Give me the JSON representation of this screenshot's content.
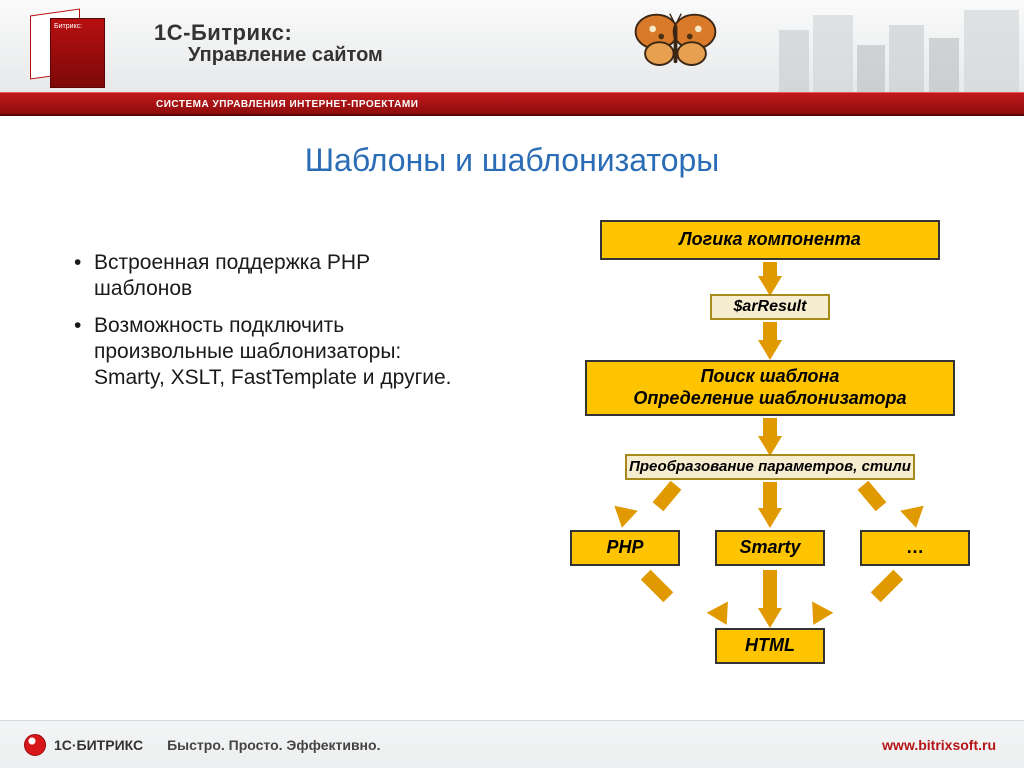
{
  "header": {
    "brand_top": "1С-Битрикс:",
    "brand_bottom": "Управление сайтом",
    "box_label": "Битрикс:",
    "redbar": "СИСТЕМА УПРАВЛЕНИЯ ИНТЕРНЕТ-ПРОЕКТАМИ"
  },
  "slide": {
    "title": "Шаблоны и шаблонизаторы",
    "bullets": [
      "Встроенная поддержка PHP шаблонов",
      "Возможность подключить произвольные шаблонизаторы: Smarty, XSLT, FastTemplate и другие."
    ]
  },
  "diagram": {
    "logic": "Логика компонента",
    "arresult": "$arResult",
    "search_line1": "Поиск шаблона",
    "search_line2": "Определение шаблонизатора",
    "params": "Преобразование параметров, стили",
    "php": "PHP",
    "smarty": "Smarty",
    "dots": "…",
    "html": "HTML"
  },
  "footer": {
    "logo_text": "1С·БИТРИКС",
    "tagline": "Быстро. Просто. Эффективно.",
    "url": "www.bitrixsoft.ru"
  },
  "chart_data": {
    "type": "flow-diagram",
    "nodes": [
      {
        "id": "logic",
        "label": "Логика компонента",
        "kind": "primary"
      },
      {
        "id": "arresult",
        "label": "$arResult",
        "kind": "data"
      },
      {
        "id": "search",
        "label": "Поиск шаблона / Определение шаблонизатора",
        "kind": "primary"
      },
      {
        "id": "params",
        "label": "Преобразование параметров, стили",
        "kind": "data"
      },
      {
        "id": "php",
        "label": "PHP",
        "kind": "engine"
      },
      {
        "id": "smarty",
        "label": "Smarty",
        "kind": "engine"
      },
      {
        "id": "other",
        "label": "…",
        "kind": "engine"
      },
      {
        "id": "html",
        "label": "HTML",
        "kind": "output"
      }
    ],
    "edges": [
      [
        "logic",
        "arresult"
      ],
      [
        "arresult",
        "search"
      ],
      [
        "search",
        "params"
      ],
      [
        "params",
        "php"
      ],
      [
        "params",
        "smarty"
      ],
      [
        "params",
        "other"
      ],
      [
        "php",
        "html"
      ],
      [
        "smarty",
        "html"
      ],
      [
        "other",
        "html"
      ]
    ]
  }
}
